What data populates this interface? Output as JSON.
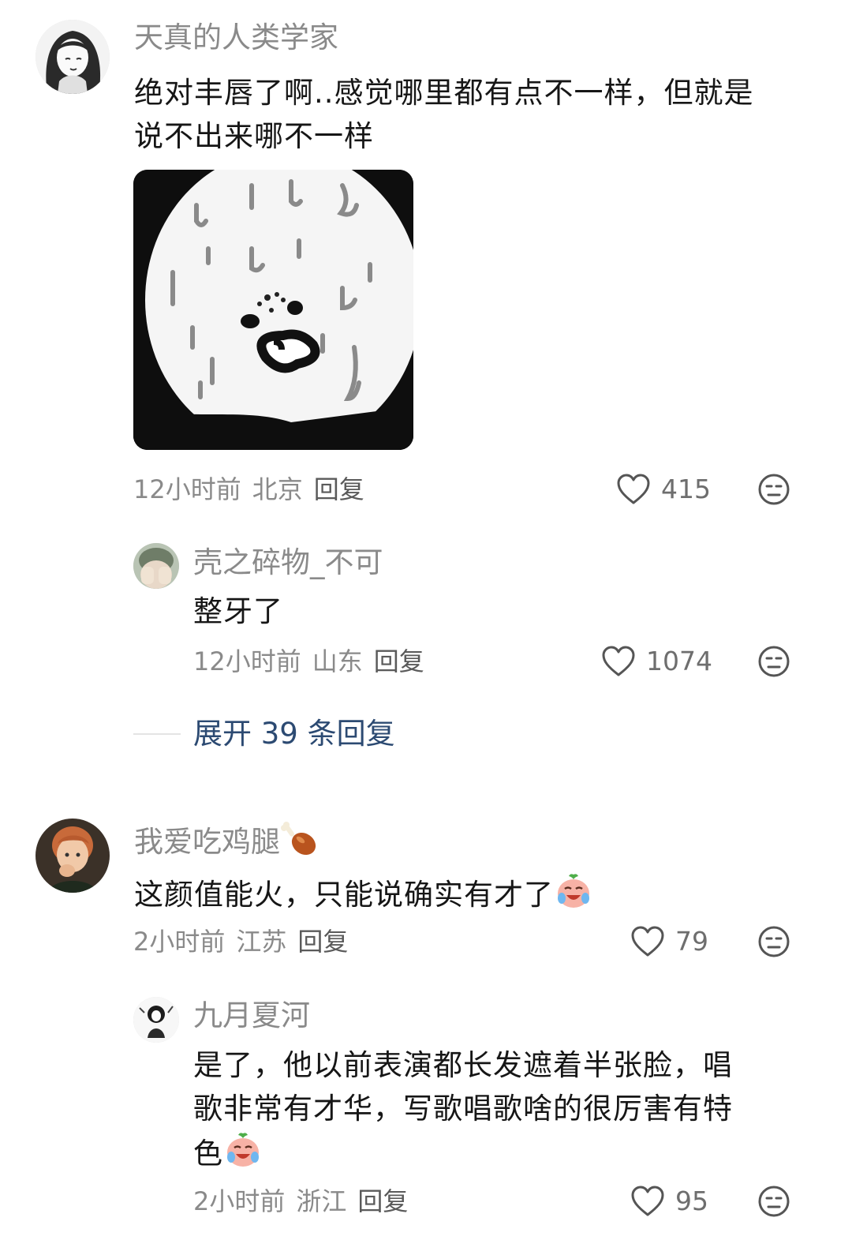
{
  "comments": [
    {
      "username": "天真的人类学家",
      "text_line1": "绝对丰唇了啊..感觉哪里都有点不一样，但就是",
      "text_line2": "说不出来哪不一样",
      "time": "12小时前",
      "location": "北京",
      "reply_label": "回复",
      "likes": "415",
      "image_icon": "sweating-cartoon-face-meme",
      "replies": [
        {
          "username": "壳之碎物_不可",
          "text": "整牙了",
          "time": "12小时前",
          "location": "山东",
          "reply_label": "回复",
          "likes": "1074"
        }
      ],
      "expand_label": "展开 39 条回复"
    },
    {
      "username": "我爱吃鸡腿",
      "username_emoji": "chicken-leg-emoji",
      "text": "这颜值能火，只能说确实有才了",
      "text_emoji": "crying-laughing-peach-emoji",
      "time": "2小时前",
      "location": "江苏",
      "reply_label": "回复",
      "likes": "79",
      "replies": [
        {
          "username": "九月夏河",
          "text_line1": "是了，他以前表演都长发遮着半张脸，唱",
          "text_line2": "歌非常有才华，写歌唱歌啥的很厉害有特",
          "text_line3": "色",
          "text_emoji": "crying-laughing-peach-emoji",
          "time": "2小时前",
          "location": "浙江",
          "reply_label": "回复",
          "likes": "95"
        }
      ]
    }
  ],
  "colors": {
    "username": "#8a8a8a",
    "meta": "#8a8a8a",
    "expand_link": "#2c4a72",
    "body_text": "#161616"
  }
}
